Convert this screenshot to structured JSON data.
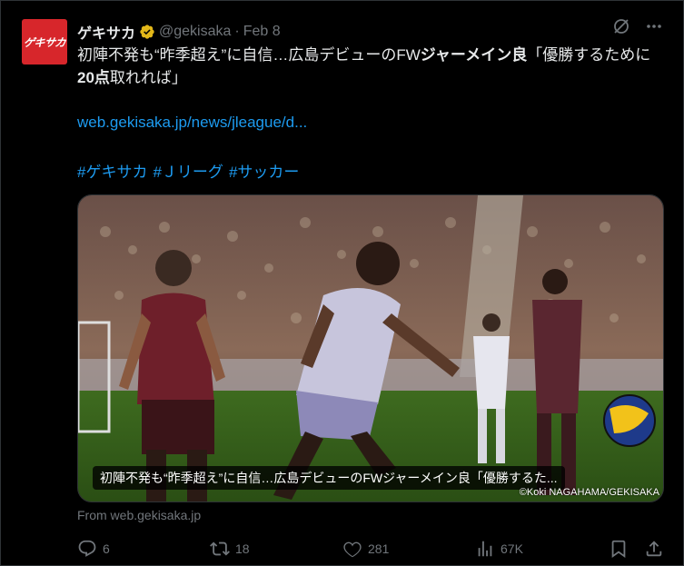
{
  "author": {
    "display_name": "ゲキサカ",
    "handle": "@gekisaka",
    "separator": "·",
    "date": "Feb 8",
    "avatar_text": "ゲキサカ",
    "avatar_color": "#d7262b",
    "verified_color": "#e2b719"
  },
  "tweet": {
    "text_part1": "初陣不発も“昨季超え”に自信…広島デビューのFW",
    "text_bold1": "ジャーメイン良",
    "text_part2": "「優勝するために",
    "text_bold2": "20点",
    "text_part3": "取れれば」",
    "link": "web.gekisaka.jp/news/jleague/d...",
    "hashtags": [
      "#ゲキサカ",
      "#Ｊリーグ",
      "#サッカー"
    ]
  },
  "card": {
    "caption": "初陣不発も“昨季超え”に自信…広島デビューのFWジャーメイン良「優勝するた...",
    "credit": "©Koki NAGAHAMA/GEKISAKA",
    "from": "From web.gekisaka.jp"
  },
  "actions": {
    "replies": "6",
    "reposts": "18",
    "likes": "281",
    "views": "67K"
  },
  "colors": {
    "background": "#000000",
    "text": "#e7e9ea",
    "secondary": "#71767b",
    "link": "#1d9bf0"
  },
  "icons": [
    "grok-icon",
    "more-icon",
    "reply-icon",
    "repost-icon",
    "like-icon",
    "views-icon",
    "bookmark-icon",
    "share-icon",
    "verified-badge-icon"
  ]
}
